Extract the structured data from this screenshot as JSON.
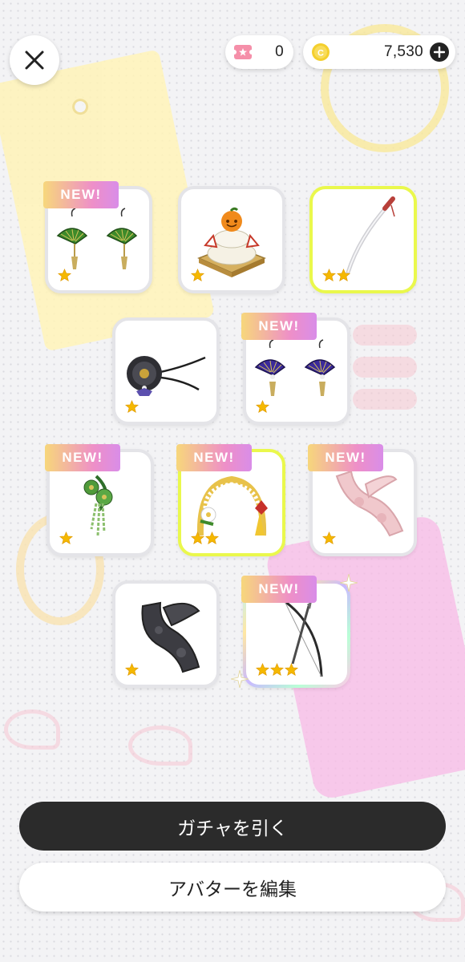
{
  "header": {
    "close_icon": "close-icon",
    "ticket": {
      "icon": "ticket-icon",
      "value": "0"
    },
    "coins": {
      "icon": "coin-icon",
      "value": "7,530",
      "add_icon": "plus-icon"
    }
  },
  "items": [
    {
      "name": "green-fan-earrings",
      "new_label": "NEW!",
      "stars": 1,
      "rarity_color": "#e4e4e8"
    },
    {
      "name": "kagami-mochi",
      "new_label": "",
      "stars": 1,
      "rarity_color": "#e4e4e8"
    },
    {
      "name": "katana",
      "new_label": "",
      "stars": 2,
      "rarity_color": "#eaf84c"
    },
    {
      "name": "black-flower-choker",
      "new_label": "",
      "stars": 1,
      "rarity_color": "#e4e4e8"
    },
    {
      "name": "purple-fan-earrings",
      "new_label": "NEW!",
      "stars": 1,
      "rarity_color": "#e4e4e8"
    },
    {
      "name": "green-flower-hair-ornament",
      "new_label": "NEW!",
      "stars": 1,
      "rarity_color": "#e4e4e8"
    },
    {
      "name": "new-year-headband",
      "new_label": "NEW!",
      "stars": 2,
      "rarity_color": "#eaf84c"
    },
    {
      "name": "pink-fur-stole",
      "new_label": "NEW!",
      "stars": 1,
      "rarity_color": "#e4e4e8"
    },
    {
      "name": "black-fur-stole",
      "new_label": "",
      "stars": 1,
      "rarity_color": "#e4e4e8"
    },
    {
      "name": "bow-and-arrow",
      "new_label": "NEW!",
      "stars": 3,
      "rarity_color": "rainbow"
    }
  ],
  "buttons": {
    "gacha": "ガチャを引く",
    "edit_avatar": "アバターを編集"
  },
  "colors": {
    "dark_button": "#2b2b2b",
    "star": "#f5b800",
    "new_badge_start": "#f7d77b",
    "new_badge_end": "#d98de8",
    "rare2_border": "#eaf84c"
  }
}
